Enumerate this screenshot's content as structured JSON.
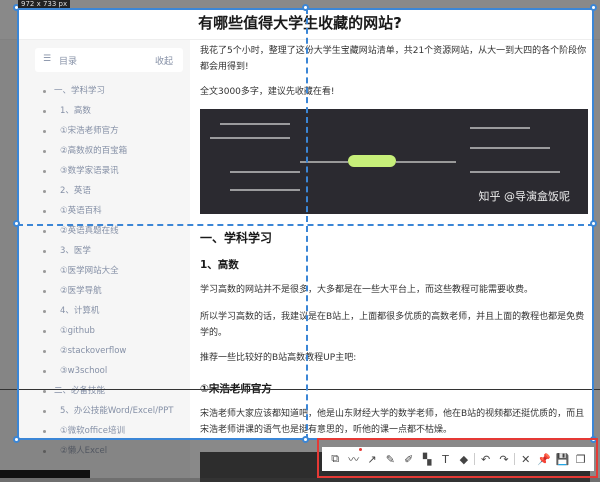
{
  "selection_size_label": "972 x 733 px",
  "article": {
    "title": "有哪些值得大学生收藏的网站?",
    "intro1": "我花了5个小时，整理了这份大学生宝藏网站清单，共21个资源网站，从大一到大四的各个阶段你都会用得到!",
    "intro2": "全文3000多字，建议先收藏在看!",
    "image_watermark": "知乎 @导演盒饭呢",
    "h_section1": "一、学科学习",
    "h_math": "1、高数",
    "p1": "学习高数的网站并不是很多，大多都是在一些大平台上，而这些教程可能需要收费。",
    "p2": "所以学习高数的话，我建议是在B站上，上面都很多优质的高数老师，并且上面的教程也都是免费学的。",
    "p3": "推荐一些比较好的B站高数教程UP主吧:",
    "h_songhao": "①宋浩老师官方",
    "p4": "宋浩老师大家应该都知道吧，他是山东财经大学的数学老师，他在B站的视频都还挺优质的，而且宋浩老师讲课的语气也是挺有意思的，听他的课一点都不枯燥。"
  },
  "toc": {
    "label": "目录",
    "fold_label": "收起",
    "items": [
      {
        "label": "一、学科学习",
        "level": 1
      },
      {
        "label": "1、高数",
        "level": 2
      },
      {
        "label": "①宋浩老师官方",
        "level": 2
      },
      {
        "label": "②高数叔的百宝箱",
        "level": 2
      },
      {
        "label": "③数学家语录讯",
        "level": 2
      },
      {
        "label": "2、英语",
        "level": 2
      },
      {
        "label": "①英语百科",
        "level": 2
      },
      {
        "label": "②英语真题在线",
        "level": 2
      },
      {
        "label": "3、医学",
        "level": 2
      },
      {
        "label": "①医学网站大全",
        "level": 2
      },
      {
        "label": "②医学导航",
        "level": 2
      },
      {
        "label": "4、计算机",
        "level": 2
      },
      {
        "label": "①github",
        "level": 2
      },
      {
        "label": "②stackoverflow",
        "level": 2
      },
      {
        "label": "③w3school",
        "level": 2
      },
      {
        "label": "二、必备技能",
        "level": 1
      },
      {
        "label": "5、办公技能Word/Excel/PPT",
        "level": 2
      },
      {
        "label": "①微软office培训",
        "level": 2
      },
      {
        "label": "②懒人Excel",
        "level": 2
      }
    ]
  },
  "toolbar": {
    "accent": "#e53935",
    "selection_color": "#3b86d6",
    "tools": [
      {
        "name": "rectangle-icon",
        "glyph": "⧉"
      },
      {
        "name": "curve-icon",
        "glyph": "〰"
      },
      {
        "name": "arrow-icon",
        "glyph": "↗"
      },
      {
        "name": "pencil-icon",
        "glyph": "✎"
      },
      {
        "name": "marker-icon",
        "glyph": "✐"
      },
      {
        "name": "mosaic-icon",
        "glyph": "▚"
      },
      {
        "name": "text-icon",
        "glyph": "T"
      },
      {
        "name": "eraser-icon",
        "glyph": "◆"
      },
      {
        "name": "undo-icon",
        "glyph": "↶"
      },
      {
        "name": "redo-icon",
        "glyph": "↷"
      },
      {
        "name": "close-icon",
        "glyph": "✕"
      },
      {
        "name": "pin-icon",
        "glyph": "📌"
      },
      {
        "name": "save-icon",
        "glyph": "💾"
      },
      {
        "name": "copy-icon",
        "glyph": "❐"
      }
    ]
  }
}
